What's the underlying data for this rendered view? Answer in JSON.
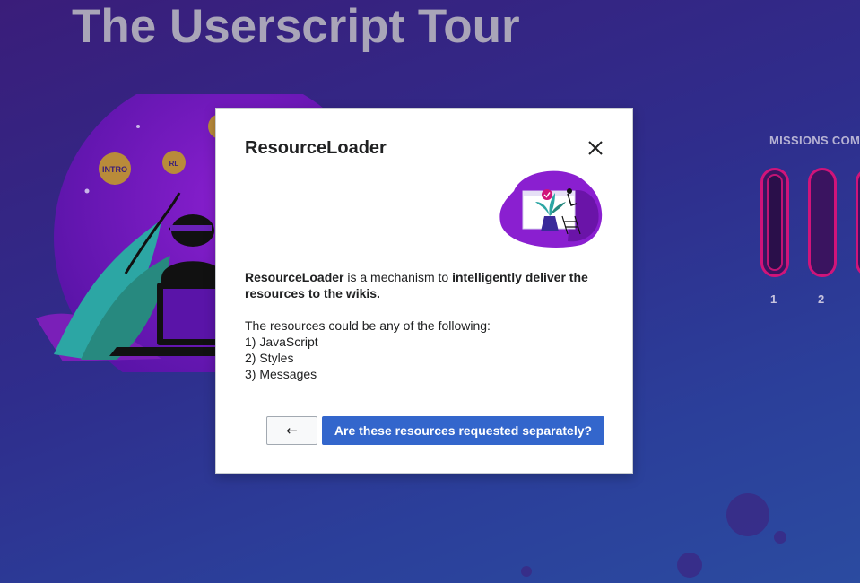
{
  "page": {
    "title": "The Userscript Tour",
    "missions_label": "MISSIONS COM",
    "missions": [
      {
        "number": "1",
        "completed": true
      },
      {
        "number": "2",
        "completed": false
      }
    ],
    "hero_badges": [
      "INTRO",
      "RL"
    ]
  },
  "dialog": {
    "title": "ResourceLoader",
    "close_icon": "close-icon",
    "intro_lead": "ResourceLoader",
    "intro_middle": " is a mechanism to ",
    "intro_emphasis": "intelligently deliver the resources to the wikis.",
    "list_intro": "The resources could be any of the following:",
    "list_items": [
      "1) JavaScript",
      "2) Styles",
      "3) Messages"
    ],
    "back_label": "←",
    "next_label": "Are these resources requested separately?"
  },
  "colors": {
    "accent": "#3366cc",
    "mission_border": "#d0147a",
    "title_text": "#a9a5b8"
  }
}
